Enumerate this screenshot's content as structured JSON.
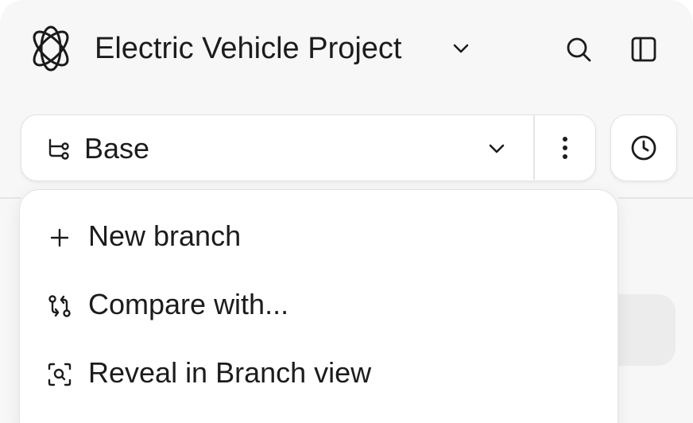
{
  "header": {
    "project_title": "Electric Vehicle Project",
    "icons": {
      "logo": "atom-orbit-logo",
      "title_dropdown": "chevron-down-icon",
      "search": "search-icon",
      "sidebar_toggle": "sidebar-panel-icon"
    }
  },
  "branch_selector": {
    "icon": "branch-icon",
    "current_branch": "Base",
    "dropdown_icon": "chevron-down-icon",
    "more_icon": "more-vertical-icon"
  },
  "history": {
    "icon": "clock-icon"
  },
  "branch_menu": {
    "items": [
      {
        "label": "New branch",
        "icon": "plus-icon"
      },
      {
        "label": "Compare with...",
        "icon": "compare-icon"
      },
      {
        "label": "Reveal in Branch view",
        "icon": "reveal-icon"
      }
    ]
  },
  "colors": {
    "background": "#f7f7f7",
    "surface": "#ffffff",
    "border": "#e2e2e2",
    "text": "#1c1c1c"
  }
}
